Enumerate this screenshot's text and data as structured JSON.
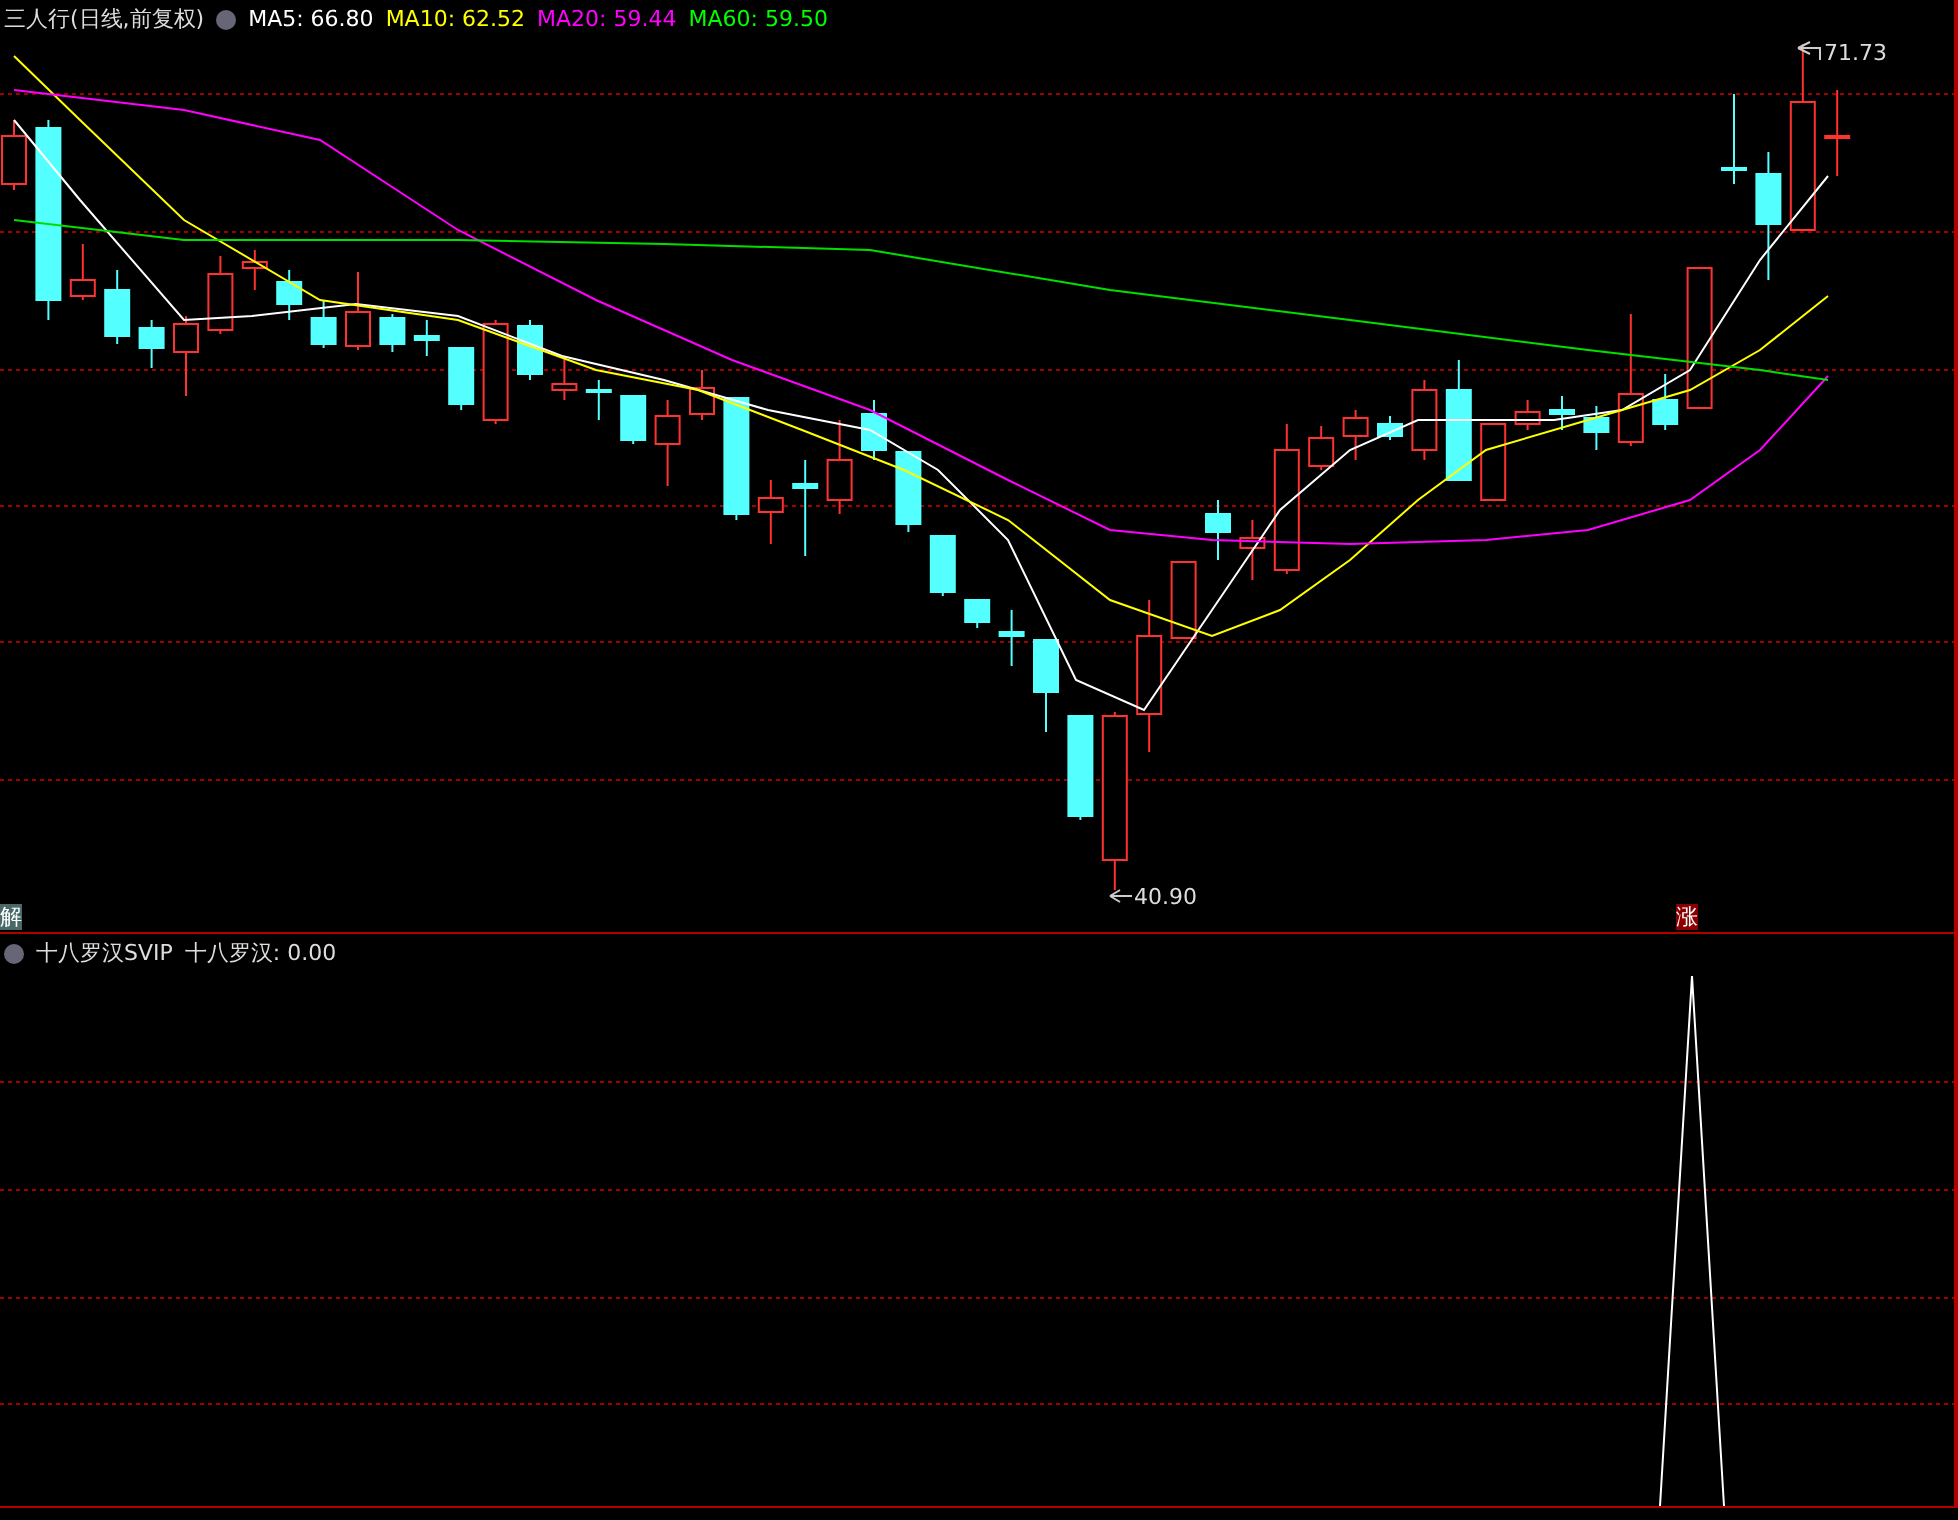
{
  "price_panel": {
    "title": "三人行(日线,前复权)",
    "moving_averages": [
      {
        "label": "MA5: 66.80",
        "color": "#ffffff"
      },
      {
        "label": "MA10: 62.52",
        "color": "#ffff00"
      },
      {
        "label": "MA20: 59.44",
        "color": "#ff00ff"
      },
      {
        "label": "MA60: 59.50",
        "color": "#00ff00"
      }
    ],
    "high_label": "71.73",
    "low_label": "40.90",
    "left_badge": "解",
    "right_badge": "涨"
  },
  "indicator_panel": {
    "name": "十八罗汉SVIP",
    "value": "十八罗汉: 0.00"
  }
}
